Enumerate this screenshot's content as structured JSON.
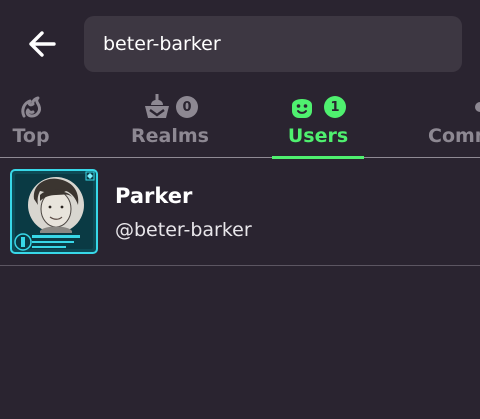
{
  "header": {
    "back_icon": "arrow-left-icon",
    "search": {
      "value": "beter-barker",
      "placeholder": ""
    }
  },
  "tabs": [
    {
      "label": "Top",
      "icon": "flame-swirl-icon",
      "badge": ""
    },
    {
      "label": "Realms",
      "icon": "realm-icon",
      "badge": "0"
    },
    {
      "label": "Users",
      "icon": "smiley-user-icon",
      "badge": "1",
      "active": true
    },
    {
      "label": "Comm",
      "icon": "community-icon",
      "badge": ""
    }
  ],
  "results": [
    {
      "display_name": "Parker",
      "handle": "@beter-barker",
      "avatar_icon": "avatar-frame-icon"
    }
  ],
  "colors": {
    "background": "#2a2430",
    "search_bg": "#3d3742",
    "accent": "#4ff06f",
    "inactive": "#8d8892"
  }
}
